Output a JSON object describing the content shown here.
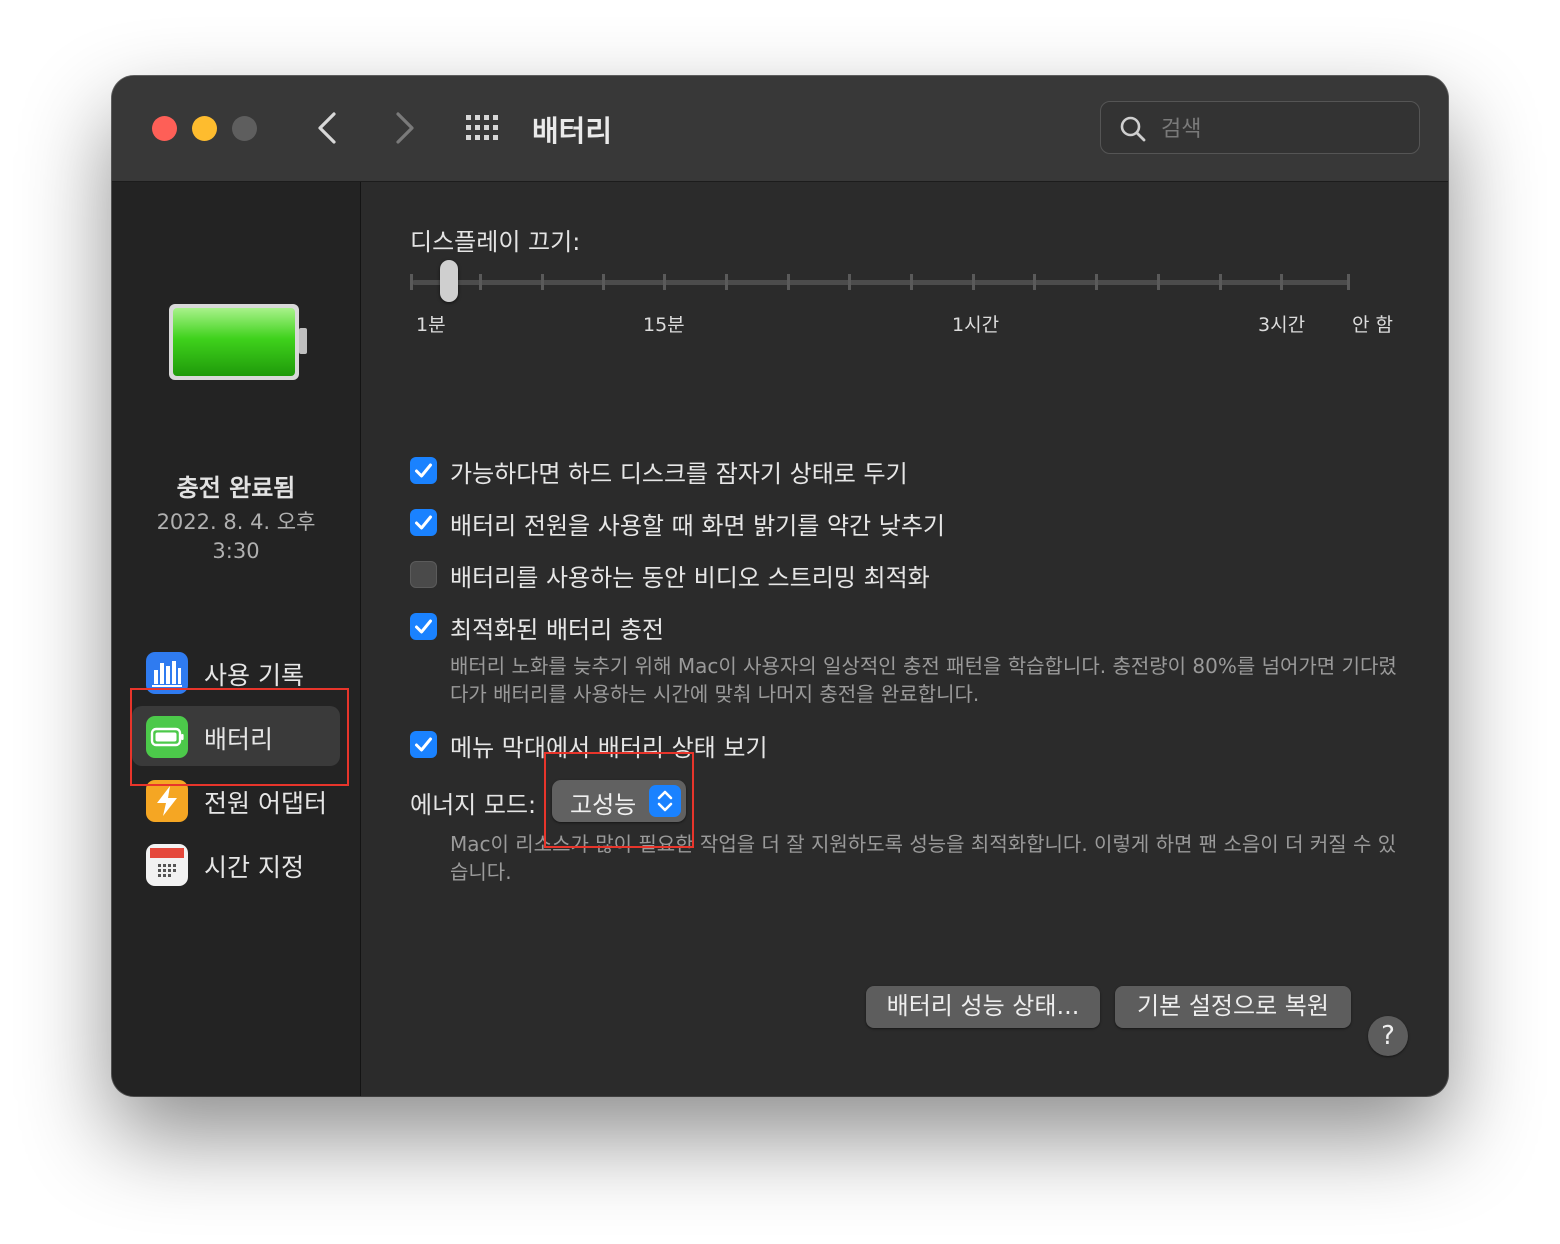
{
  "window": {
    "title": "배터리",
    "search_placeholder": "검색"
  },
  "sidebar": {
    "status_title": "충전 완료됨",
    "status_date": "2022. 8. 4. 오후 3:30",
    "items": [
      {
        "label": "사용 기록",
        "icon": "usage-history-icon"
      },
      {
        "label": "배터리",
        "icon": "battery-icon",
        "selected": true
      },
      {
        "label": "전원 어댑터",
        "icon": "power-adapter-icon"
      },
      {
        "label": "시간 지정",
        "icon": "schedule-calendar-icon"
      }
    ]
  },
  "display_off": {
    "label": "디스플레이 끄기:",
    "tick_labels": [
      "1분",
      "15분",
      "1시간",
      "3시간",
      "안 함"
    ],
    "slider_value": "1분"
  },
  "options": [
    {
      "label": "가능하다면 하드 디스크를 잠자기 상태로 두기",
      "checked": true
    },
    {
      "label": "배터리 전원을 사용할 때 화면 밝기를 약간 낮추기",
      "checked": true
    },
    {
      "label": "배터리를 사용하는 동안 비디오 스트리밍 최적화",
      "checked": false
    },
    {
      "label": "최적화된 배터리 충전",
      "checked": true,
      "description": "배터리 노화를 늦추기 위해 Mac이 사용자의 일상적인 충전 패턴을 학습합니다. 충전량이 80%를 넘어가면 기다렸다가 배터리를 사용하는 시간에 맞춰 나머지 충전을 완료합니다."
    },
    {
      "label": "메뉴 막대에서 배터리 상태 보기",
      "checked": true
    }
  ],
  "energy_mode": {
    "label": "에너지 모드:",
    "value": "고성능",
    "description": "Mac이 리소스가 많이 필요한 작업을 더 잘 지원하도록 성능을 최적화합니다. 이렇게 하면 팬 소음이 더 커질 수 있습니다."
  },
  "buttons": {
    "battery_health": "배터리 성능 상태...",
    "restore_defaults": "기본 설정으로 복원",
    "help": "?"
  },
  "colors": {
    "accent": "#1a82ff",
    "highlight": "#e8352b",
    "battery_green": "#3fd21c"
  }
}
